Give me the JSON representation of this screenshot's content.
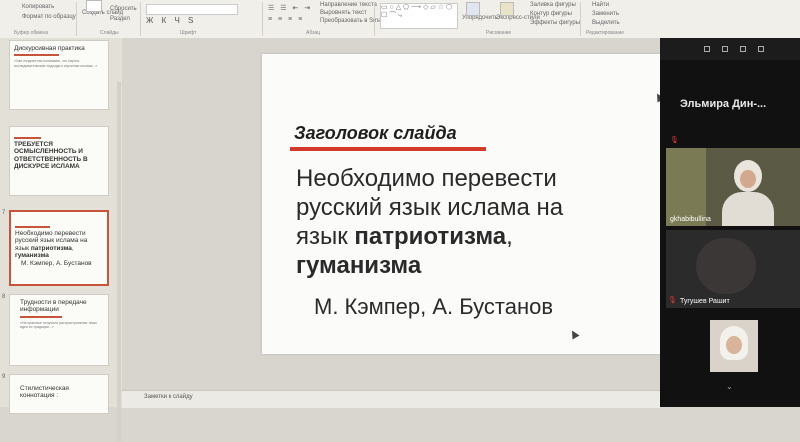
{
  "ribbon": {
    "items": [
      "Копировать",
      "Формат по образцу",
      "Создать слайд",
      "Сбросить",
      "Раздел",
      "Направление текста",
      "Выровнять текст",
      "Преобразовать в SmartArt",
      "Упорядочить",
      "Экспресс-стили",
      "Заливка фигуры",
      "Контур фигуры",
      "Эффекты фигуры",
      "Найти",
      "Заменить",
      "Выделить"
    ],
    "groups": [
      "Буфер обмена",
      "Слайды",
      "Шрифт",
      "Абзац",
      "Рисование",
      "Редактирование"
    ]
  },
  "thumbnails": [
    {
      "title": "Дискурсивная практика",
      "small": "«Уже позднее мы понимаем, что научно-исследовательские подходы к изучению ислама...»"
    },
    {
      "num": "",
      "title": "Требуется осмысленность и ответственность в дискурсе ислама"
    },
    {
      "num": "7",
      "l1": "Необходимо перевести",
      "l2": "русский язык ислама на",
      "l3a": "язык ",
      "l3b": "патриотизма",
      "l3c": ",",
      "l4": "гуманизма",
      "author": "М. Кэмпер, А. Бустанов"
    },
    {
      "num": "8",
      "title": "Трудности в передаче информации",
      "small": "«На практике получили распространение лишь идеи из традиции...»"
    },
    {
      "num": "9",
      "title": "Стилистическая коннотация :"
    }
  ],
  "slide": {
    "title": "Заголовок слайда",
    "body_l1": "Необходимо перевести",
    "body_l2": "русский язык ислама на",
    "body_l3a": "язык ",
    "body_l3b": "патриотизма",
    "body_l3c": ",",
    "body_l4": "гуманизма",
    "author": "М. Кэмпер, А. Бустанов"
  },
  "notes": {
    "placeholder": "Заметки к слайду"
  },
  "zoom": {
    "speaker_name": "Эльмира Дин-...",
    "participants": [
      {
        "name": "gkhabibullina"
      },
      {
        "name": "Тугушев Рашит"
      },
      {
        "name": ""
      }
    ]
  },
  "colors": {
    "accent": "#d43a2a",
    "selection": "#c8553a"
  }
}
